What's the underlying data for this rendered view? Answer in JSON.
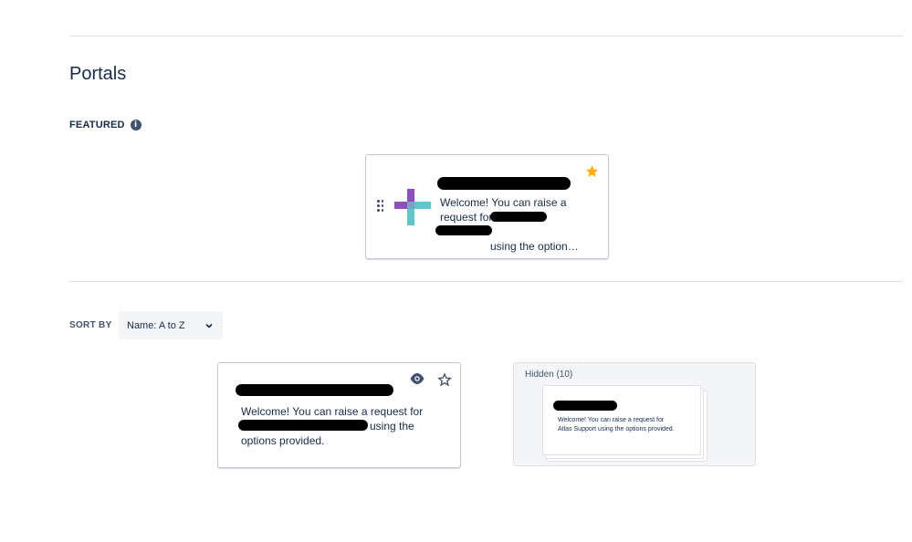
{
  "portals": {
    "title": "Portals",
    "featured_label": "FEATURED",
    "featured_card": {
      "text": "Welcome! You can raise a request for",
      "text_tail": "using the option…",
      "starred": true
    },
    "sort": {
      "label": "SORT BY",
      "value": "Name: A to Z"
    },
    "portal_card": {
      "text": "Welcome! You can raise a request for",
      "text_tail": "using the",
      "text_line3": "options provided."
    },
    "hidden": {
      "label": "Hidden (10)",
      "card_text_1": "Welcome! You can raise a request for",
      "card_text_2": "Atlas Support using the options provided."
    }
  },
  "colors": {
    "star_gold": "#ffab00",
    "logo_purple": "#8f4fbd",
    "logo_teal": "#5fc6c9",
    "icon_dark": "#42526e"
  },
  "icons": {
    "info": "info-circle-icon",
    "drag": "drag-handle-icon",
    "star_filled": "star-filled-icon",
    "star_outline": "star-outline-icon",
    "eye": "eye-icon",
    "chevron": "chevron-down-icon"
  }
}
